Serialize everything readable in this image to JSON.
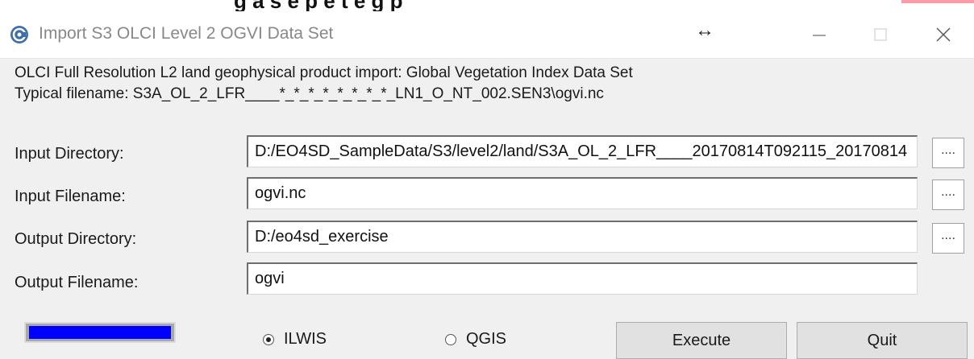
{
  "window": {
    "title": "Import S3 OLCI Level 2 OGVI Data Set",
    "top_clip_text": "g a s e  p   e  t  e  g      p",
    "resize_glyph": "↔",
    "min_glyph": "—",
    "max_glyph": "□",
    "close_glyph": "✕"
  },
  "description": {
    "line1": "OLCI Full Resolution L2 land geophysical product import: Global Vegetation Index Data Set",
    "line2": "Typical filename: S3A_OL_2_LFR____*_*_*_*_*_*_*_*_LN1_O_NT_002.SEN3\\ogvi.nc"
  },
  "fields": [
    {
      "label": "Input Directory:",
      "value": "D:/EO4SD_SampleData/S3/level2/land/S3A_OL_2_LFR____20170814T092115_20170814",
      "browse": "...."
    },
    {
      "label": "Input Filename:",
      "value": "ogvi.nc",
      "browse": "...."
    },
    {
      "label": "Output Directory:",
      "value": "D:/eo4sd_exercise",
      "browse": "...."
    },
    {
      "label": "Output Filename:",
      "value": "ogvi"
    }
  ],
  "progress": {
    "fraction": 1.0,
    "color": "#0000ff"
  },
  "options": [
    {
      "label": "ILWIS",
      "checked": true
    },
    {
      "label": "QGIS",
      "checked": false
    }
  ],
  "buttons": {
    "execute": "Execute",
    "quit": "Quit"
  },
  "colors": {
    "title_text": "#888888",
    "accent_blue": "#0000ff"
  }
}
